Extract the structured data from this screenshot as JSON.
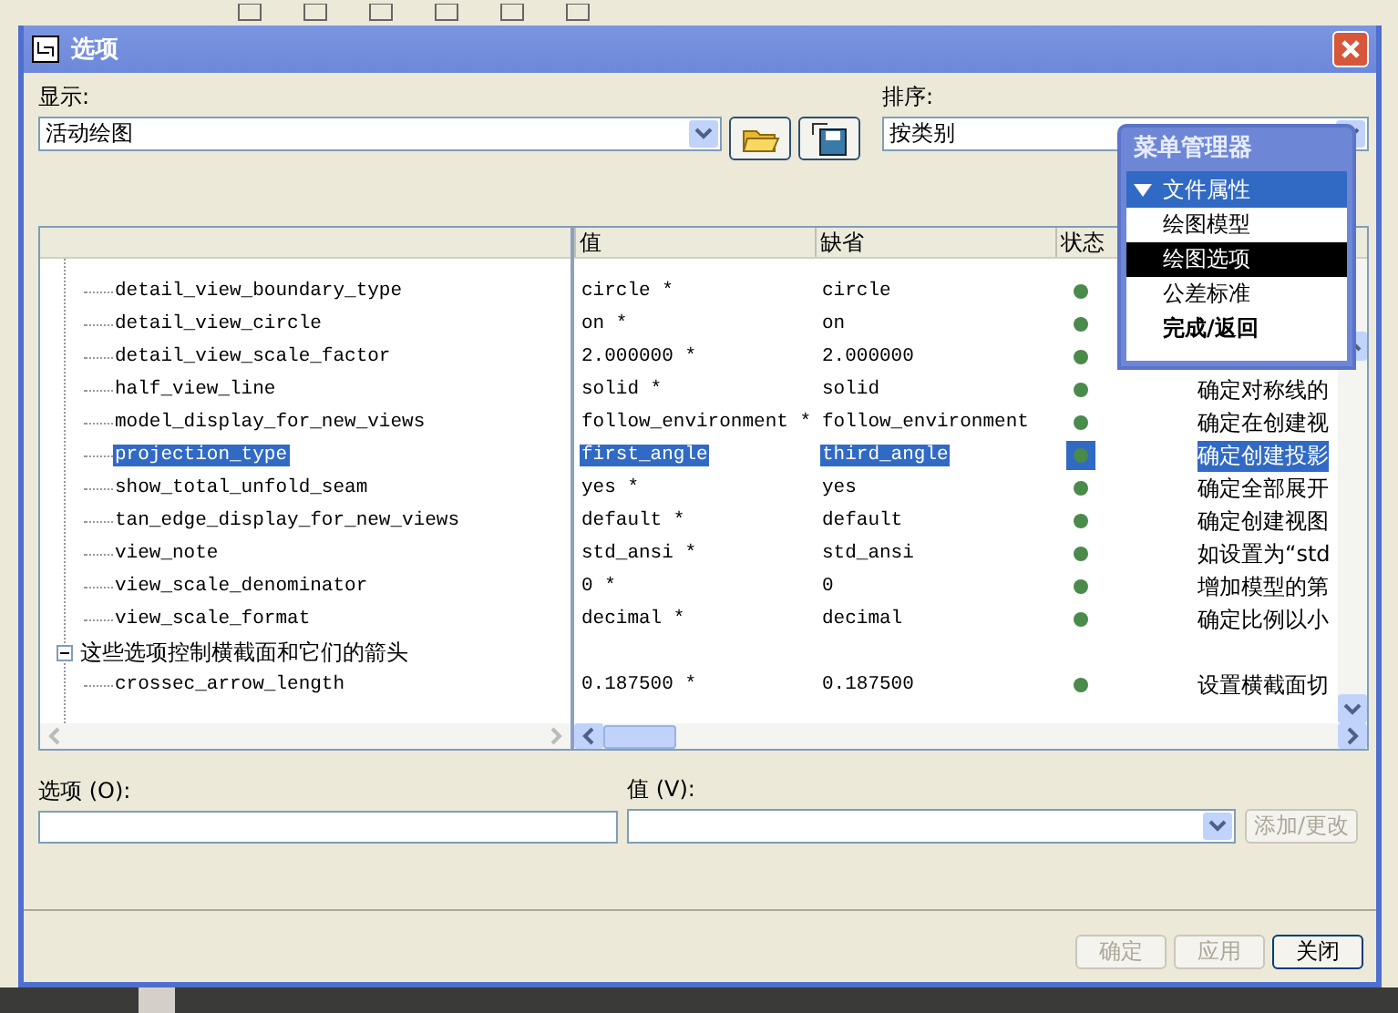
{
  "window": {
    "title": "选项"
  },
  "display": {
    "label": "显示:",
    "value": "活动绘图"
  },
  "sort": {
    "label": "排序:",
    "value": "按类别"
  },
  "table": {
    "columns": [
      "值",
      "缺省",
      "状态"
    ],
    "rows": [
      {
        "kind": "option",
        "name": "detail_view_boundary_type",
        "value": "circle *",
        "default": "circle",
        "selected": false
      },
      {
        "kind": "option",
        "name": "detail_view_circle",
        "value": "on *",
        "default": "on",
        "selected": false
      },
      {
        "kind": "option",
        "name": "detail_view_scale_factor",
        "value": "2.000000 *",
        "default": "2.000000",
        "selected": false
      },
      {
        "kind": "option",
        "name": "half_view_line",
        "value": "solid *",
        "default": "solid",
        "description": "确定对称线的",
        "selected": false
      },
      {
        "kind": "option",
        "name": "model_display_for_new_views",
        "value": "follow_environment *",
        "default": "follow_environment",
        "description": "确定在创建视",
        "selected": false
      },
      {
        "kind": "option",
        "name": "projection_type",
        "value": "first_angle",
        "default": "third_angle",
        "description": "确定创建投影",
        "selected": true
      },
      {
        "kind": "option",
        "name": "show_total_unfold_seam",
        "value": "yes *",
        "default": "yes",
        "description": "确定全部展开",
        "selected": false
      },
      {
        "kind": "option",
        "name": "tan_edge_display_for_new_views",
        "value": "default *",
        "default": "default",
        "description": "确定创建视图",
        "selected": false
      },
      {
        "kind": "option",
        "name": "view_note",
        "value": "std_ansi *",
        "default": "std_ansi",
        "description": "如设置为“std",
        "selected": false
      },
      {
        "kind": "option",
        "name": "view_scale_denominator",
        "value": "0 *",
        "default": "0",
        "description": "增加模型的第",
        "selected": false
      },
      {
        "kind": "option",
        "name": "view_scale_format",
        "value": "decimal *",
        "default": "decimal",
        "description": "确定比例以小",
        "selected": false
      },
      {
        "kind": "group",
        "label": "这些选项控制横截面和它们的箭头",
        "expanded": true
      },
      {
        "kind": "option",
        "name": "crossec_arrow_length",
        "value": "0.187500 *",
        "default": "0.187500",
        "description": "设置横截面切",
        "selected": false
      }
    ]
  },
  "option_field": {
    "label": "选项 (O):"
  },
  "value_field": {
    "label": "值 (V):"
  },
  "add_button": {
    "label": "添加/更改",
    "disabled": true
  },
  "buttons": [
    {
      "label": "确定",
      "disabled": true
    },
    {
      "label": "应用",
      "disabled": true
    },
    {
      "label": "关闭",
      "disabled": false
    }
  ],
  "menu_manager": {
    "title": "菜单管理器",
    "section": "文件属性",
    "items": [
      {
        "label": "绘图模型",
        "selected": false,
        "kind": "item"
      },
      {
        "label": "绘图选项",
        "selected": true,
        "kind": "item"
      },
      {
        "label": "公差标准",
        "selected": false,
        "kind": "item"
      },
      {
        "label": "完成/返回",
        "selected": false,
        "kind": "action"
      }
    ]
  }
}
